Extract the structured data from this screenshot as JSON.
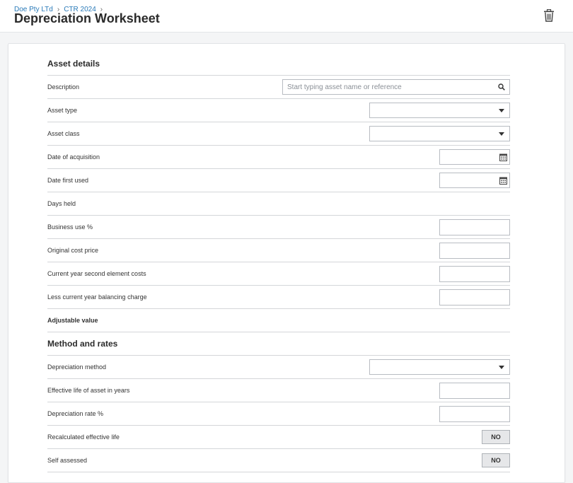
{
  "header": {
    "breadcrumb": [
      "Doe Pty LTd",
      "CTR 2024"
    ],
    "breadcrumb_separator": "›",
    "title": "Depreciation Worksheet"
  },
  "sections": {
    "asset_details": "Asset details",
    "method_rates": "Method and rates"
  },
  "fields": {
    "description": {
      "label": "Description",
      "placeholder": "Start typing asset name or reference"
    },
    "asset_type": {
      "label": "Asset type",
      "value": ""
    },
    "asset_class": {
      "label": "Asset class",
      "value": ""
    },
    "date_acquisition": {
      "label": "Date of acquisition"
    },
    "date_first_used": {
      "label": "Date first used"
    },
    "days_held": {
      "label": "Days held"
    },
    "business_use": {
      "label": "Business use %"
    },
    "original_cost": {
      "label": "Original cost price"
    },
    "second_element": {
      "label": "Current year second element costs"
    },
    "balancing_charge": {
      "label": "Less current year balancing charge"
    },
    "adjustable_value": {
      "label": "Adjustable value"
    },
    "depreciation_method": {
      "label": "Depreciation method",
      "value": ""
    },
    "effective_life": {
      "label": "Effective life of asset in years"
    },
    "depreciation_rate": {
      "label": "Depreciation rate %"
    },
    "recalculated_life": {
      "label": "Recalculated effective life",
      "toggle": "NO"
    },
    "self_assessed": {
      "label": "Self assessed",
      "toggle": "NO"
    }
  },
  "icons": {
    "trash": "trash-icon",
    "search": "search-icon",
    "dropdown": "chevron-down-icon",
    "calendar": "calendar-icon"
  },
  "colors": {
    "link": "#2a7ab8",
    "border": "#d4d6d9"
  }
}
